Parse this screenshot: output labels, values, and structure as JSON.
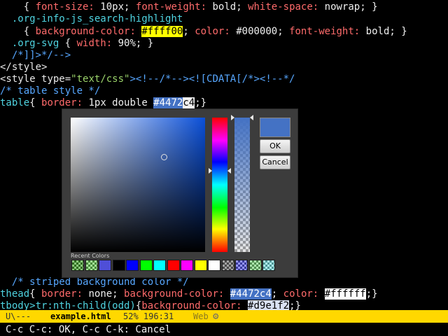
{
  "editor": {
    "l1": {
      "a": "    { ",
      "p1": "font-size:",
      "v1": " 10px; ",
      "p2": "font-weight:",
      "v2": " bold; ",
      "p3": "white-space:",
      "v3": " nowrap; }"
    },
    "l2": {
      "sel": "  .org-info-js_search-highlight"
    },
    "l3": {
      "a": "    { ",
      "p1": "background-color:",
      "sp": " ",
      "v1": "#ffff00",
      "semi": ";",
      "p2": " color:",
      "v2": " #000000; ",
      "p3": "font-weight:",
      "v3": " bold; }"
    },
    "l4": {
      "sel": "  .org-svg",
      "a": " { ",
      "p1": "width:",
      "v1": " 90%; }"
    },
    "l5": {
      "t": "  /*]]>*/-->"
    },
    "l6": {
      "t": "</style>"
    },
    "l7": {
      "a": "<style ",
      "b": "type=",
      "c": "\"text/css\"",
      "d": "><!--/*--><![CDATA[/*><!--*/"
    },
    "l8": {
      "t": "/* table style */"
    },
    "l9": {
      "sel": "table",
      "a": "{ ",
      "p1": "border:",
      "v1": " 1px double ",
      "hl": "#4472",
      "cur": "c4",
      "end": ";}"
    },
    "l10": {
      "t": "  /* striped background color */"
    },
    "l11": {
      "sel": "thead",
      "a": "{ ",
      "p1": "border:",
      "v1": " none; ",
      "p2": "background-color:",
      "sp": " ",
      "h1": "#4472c4",
      "semi": ";",
      "p3": " color:",
      "sp2": " ",
      "h2": "#ffffff",
      "end": ";}"
    },
    "l12": {
      "sel": "tbody>tr:nth-child(odd)",
      "a": "{",
      "p1": "background-color:",
      "sp": " ",
      "h1": "#d9e1f2",
      "end": ";}"
    }
  },
  "picker": {
    "recent_label": "Recent Colors",
    "ok_label": "OK",
    "cancel_label": "Cancel",
    "current_color": "#4472c4",
    "recent_colors": [
      "#4aa832",
      "#6ed35a",
      "#4f4fd8",
      "#000000",
      "#0000ff",
      "#00ff00",
      "#00ffff",
      "#ff0000",
      "#ff00ff",
      "#ffff00",
      "#ffffff",
      "#707070",
      "#5a5af0",
      "#7dd97d",
      "#7ee8e8"
    ]
  },
  "modeline": {
    "state": "U\\---",
    "buffer": "example.html",
    "position": "52% 196:31",
    "mode": "Web",
    "gear_icon": "gear-icon"
  },
  "minibuffer": "C-c C-c: OK, C-c C-k: Cancel"
}
